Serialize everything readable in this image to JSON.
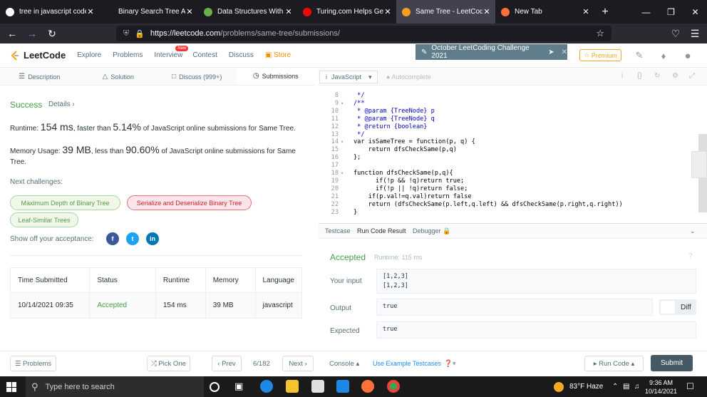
{
  "browser": {
    "tabs": [
      {
        "title": "tree in javascript code - G",
        "favicon": "google-icon",
        "color": "#ffffff"
      },
      {
        "title": "Binary Search Tree Algori",
        "favicon": "algo-icon",
        "color": "#1c1b22"
      },
      {
        "title": "Data Structures With Jav",
        "favicon": "leaf-icon",
        "color": "#6ab04c"
      },
      {
        "title": "Turing.com Helps Get To",
        "favicon": "youtube-icon",
        "color": "#ff0000"
      },
      {
        "title": "Same Tree - LeetCode",
        "favicon": "leetcode-icon",
        "color": "#f89f1b"
      },
      {
        "title": "New Tab",
        "favicon": "firefox-icon",
        "color": "#ff7139"
      }
    ],
    "url_host": "https://leetcode.com",
    "url_path": "/problems/same-tree/submissions/"
  },
  "header": {
    "logo": "LeetCode",
    "nav": [
      "Explore",
      "Problems",
      "Interview",
      "Contest",
      "Discuss"
    ],
    "new_badge": "New",
    "store": "Store",
    "challenge": "October LeetCoding Challenge 2021",
    "premium": "Premium"
  },
  "left_tabs": [
    "Description",
    "Solution",
    "Discuss (999+)",
    "Submissions"
  ],
  "result": {
    "status": "Success",
    "details": "Details",
    "runtime_pre": "Runtime: ",
    "runtime_val": "154 ms",
    "runtime_mid": ", faster than ",
    "runtime_pct": "5.14%",
    "runtime_post": " of JavaScript online submissions for Same Tree.",
    "memory_pre": "Memory Usage: ",
    "memory_val": "39 MB",
    "memory_mid": ", less than ",
    "memory_pct": "90.60%",
    "memory_post": " of JavaScript online submissions for Same Tree.",
    "next_challenges": "Next challenges:",
    "challenges": [
      "Maximum Depth of Binary Tree",
      "Serialize and Deserialize Binary Tree",
      "Leaf-Similar Trees"
    ],
    "share": "Show off your acceptance:"
  },
  "table": {
    "headers": [
      "Time Submitted",
      "Status",
      "Runtime",
      "Memory",
      "Language"
    ],
    "row": [
      "10/14/2021 09:35",
      "Accepted",
      "154 ms",
      "39 MB",
      "javascript"
    ]
  },
  "editor": {
    "language": "JavaScript",
    "autocomplete": "Autocomplete",
    "lines": [
      {
        "n": "8",
        "t": " */",
        "c": "cm"
      },
      {
        "n": "9",
        "t": "/**",
        "c": "cm",
        "fold": true
      },
      {
        "n": "10",
        "t": " * @param {TreeNode} p",
        "c": "cm"
      },
      {
        "n": "11",
        "t": " * @param {TreeNode} q",
        "c": "cm"
      },
      {
        "n": "12",
        "t": " * @return {boolean}",
        "c": "cm"
      },
      {
        "n": "13",
        "t": " */",
        "c": "cm"
      },
      {
        "n": "14",
        "t": "var isSameTree = function(p, q) {",
        "c": "",
        "fold": true
      },
      {
        "n": "15",
        "t": "    return dfsCheckSame(p,q)",
        "c": ""
      },
      {
        "n": "16",
        "t": "};",
        "c": ""
      },
      {
        "n": "17",
        "t": "",
        "c": ""
      },
      {
        "n": "18",
        "t": "function dfsCheckSame(p,q){",
        "c": "",
        "fold": true
      },
      {
        "n": "19",
        "t": "      if(!p && !q)return true;",
        "c": ""
      },
      {
        "n": "20",
        "t": "      if(!p || !q)return false;",
        "c": ""
      },
      {
        "n": "21",
        "t": "    if(p.val!=q.val)return false",
        "c": ""
      },
      {
        "n": "22",
        "t": "    return (dfsCheckSame(p.left,q.left) && dfsCheckSame(p.right,q.right))",
        "c": ""
      },
      {
        "n": "23",
        "t": "}",
        "c": ""
      }
    ]
  },
  "run": {
    "tabs": [
      "Testcase",
      "Run Code Result",
      "Debugger"
    ],
    "status": "Accepted",
    "runtime": "Runtime: 115 ms",
    "input_label": "Your input",
    "input": [
      "[1,2,3]",
      "[1,2,3]"
    ],
    "output_label": "Output",
    "output": "true",
    "diff": "Diff",
    "expected_label": "Expected",
    "expected": "true"
  },
  "bottom": {
    "problems": "Problems",
    "pick_one": "Pick One",
    "prev": "Prev",
    "page": "6/182",
    "next": "Next",
    "console": "Console",
    "use_example": "Use Example Testcases",
    "run_code": "Run Code",
    "submit": "Submit"
  },
  "taskbar": {
    "search": "Type here to search",
    "weather": "83°F  Haze",
    "time": "9:36 AM",
    "date": "10/14/2021"
  }
}
